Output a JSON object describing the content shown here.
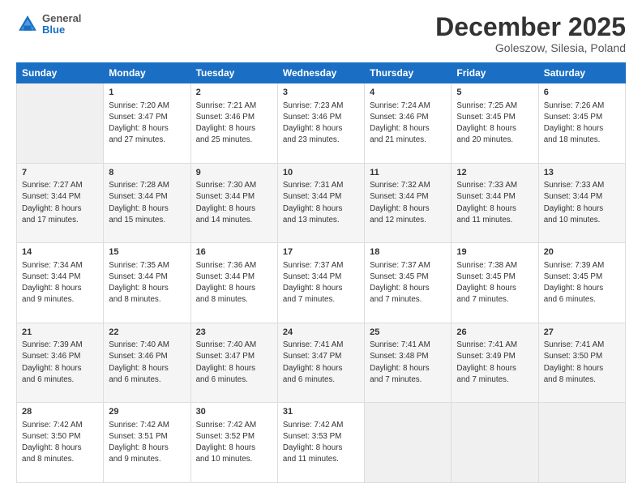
{
  "logo": {
    "general": "General",
    "blue": "Blue"
  },
  "header": {
    "month": "December 2025",
    "location": "Goleszow, Silesia, Poland"
  },
  "days_of_week": [
    "Sunday",
    "Monday",
    "Tuesday",
    "Wednesday",
    "Thursday",
    "Friday",
    "Saturday"
  ],
  "weeks": [
    [
      {
        "num": "",
        "info": ""
      },
      {
        "num": "1",
        "info": "Sunrise: 7:20 AM\nSunset: 3:47 PM\nDaylight: 8 hours\nand 27 minutes."
      },
      {
        "num": "2",
        "info": "Sunrise: 7:21 AM\nSunset: 3:46 PM\nDaylight: 8 hours\nand 25 minutes."
      },
      {
        "num": "3",
        "info": "Sunrise: 7:23 AM\nSunset: 3:46 PM\nDaylight: 8 hours\nand 23 minutes."
      },
      {
        "num": "4",
        "info": "Sunrise: 7:24 AM\nSunset: 3:46 PM\nDaylight: 8 hours\nand 21 minutes."
      },
      {
        "num": "5",
        "info": "Sunrise: 7:25 AM\nSunset: 3:45 PM\nDaylight: 8 hours\nand 20 minutes."
      },
      {
        "num": "6",
        "info": "Sunrise: 7:26 AM\nSunset: 3:45 PM\nDaylight: 8 hours\nand 18 minutes."
      }
    ],
    [
      {
        "num": "7",
        "info": "Sunrise: 7:27 AM\nSunset: 3:44 PM\nDaylight: 8 hours\nand 17 minutes."
      },
      {
        "num": "8",
        "info": "Sunrise: 7:28 AM\nSunset: 3:44 PM\nDaylight: 8 hours\nand 15 minutes."
      },
      {
        "num": "9",
        "info": "Sunrise: 7:30 AM\nSunset: 3:44 PM\nDaylight: 8 hours\nand 14 minutes."
      },
      {
        "num": "10",
        "info": "Sunrise: 7:31 AM\nSunset: 3:44 PM\nDaylight: 8 hours\nand 13 minutes."
      },
      {
        "num": "11",
        "info": "Sunrise: 7:32 AM\nSunset: 3:44 PM\nDaylight: 8 hours\nand 12 minutes."
      },
      {
        "num": "12",
        "info": "Sunrise: 7:33 AM\nSunset: 3:44 PM\nDaylight: 8 hours\nand 11 minutes."
      },
      {
        "num": "13",
        "info": "Sunrise: 7:33 AM\nSunset: 3:44 PM\nDaylight: 8 hours\nand 10 minutes."
      }
    ],
    [
      {
        "num": "14",
        "info": "Sunrise: 7:34 AM\nSunset: 3:44 PM\nDaylight: 8 hours\nand 9 minutes."
      },
      {
        "num": "15",
        "info": "Sunrise: 7:35 AM\nSunset: 3:44 PM\nDaylight: 8 hours\nand 8 minutes."
      },
      {
        "num": "16",
        "info": "Sunrise: 7:36 AM\nSunset: 3:44 PM\nDaylight: 8 hours\nand 8 minutes."
      },
      {
        "num": "17",
        "info": "Sunrise: 7:37 AM\nSunset: 3:44 PM\nDaylight: 8 hours\nand 7 minutes."
      },
      {
        "num": "18",
        "info": "Sunrise: 7:37 AM\nSunset: 3:45 PM\nDaylight: 8 hours\nand 7 minutes."
      },
      {
        "num": "19",
        "info": "Sunrise: 7:38 AM\nSunset: 3:45 PM\nDaylight: 8 hours\nand 7 minutes."
      },
      {
        "num": "20",
        "info": "Sunrise: 7:39 AM\nSunset: 3:45 PM\nDaylight: 8 hours\nand 6 minutes."
      }
    ],
    [
      {
        "num": "21",
        "info": "Sunrise: 7:39 AM\nSunset: 3:46 PM\nDaylight: 8 hours\nand 6 minutes."
      },
      {
        "num": "22",
        "info": "Sunrise: 7:40 AM\nSunset: 3:46 PM\nDaylight: 8 hours\nand 6 minutes."
      },
      {
        "num": "23",
        "info": "Sunrise: 7:40 AM\nSunset: 3:47 PM\nDaylight: 8 hours\nand 6 minutes."
      },
      {
        "num": "24",
        "info": "Sunrise: 7:41 AM\nSunset: 3:47 PM\nDaylight: 8 hours\nand 6 minutes."
      },
      {
        "num": "25",
        "info": "Sunrise: 7:41 AM\nSunset: 3:48 PM\nDaylight: 8 hours\nand 7 minutes."
      },
      {
        "num": "26",
        "info": "Sunrise: 7:41 AM\nSunset: 3:49 PM\nDaylight: 8 hours\nand 7 minutes."
      },
      {
        "num": "27",
        "info": "Sunrise: 7:41 AM\nSunset: 3:50 PM\nDaylight: 8 hours\nand 8 minutes."
      }
    ],
    [
      {
        "num": "28",
        "info": "Sunrise: 7:42 AM\nSunset: 3:50 PM\nDaylight: 8 hours\nand 8 minutes."
      },
      {
        "num": "29",
        "info": "Sunrise: 7:42 AM\nSunset: 3:51 PM\nDaylight: 8 hours\nand 9 minutes."
      },
      {
        "num": "30",
        "info": "Sunrise: 7:42 AM\nSunset: 3:52 PM\nDaylight: 8 hours\nand 10 minutes."
      },
      {
        "num": "31",
        "info": "Sunrise: 7:42 AM\nSunset: 3:53 PM\nDaylight: 8 hours\nand 11 minutes."
      },
      {
        "num": "",
        "info": ""
      },
      {
        "num": "",
        "info": ""
      },
      {
        "num": "",
        "info": ""
      }
    ]
  ]
}
